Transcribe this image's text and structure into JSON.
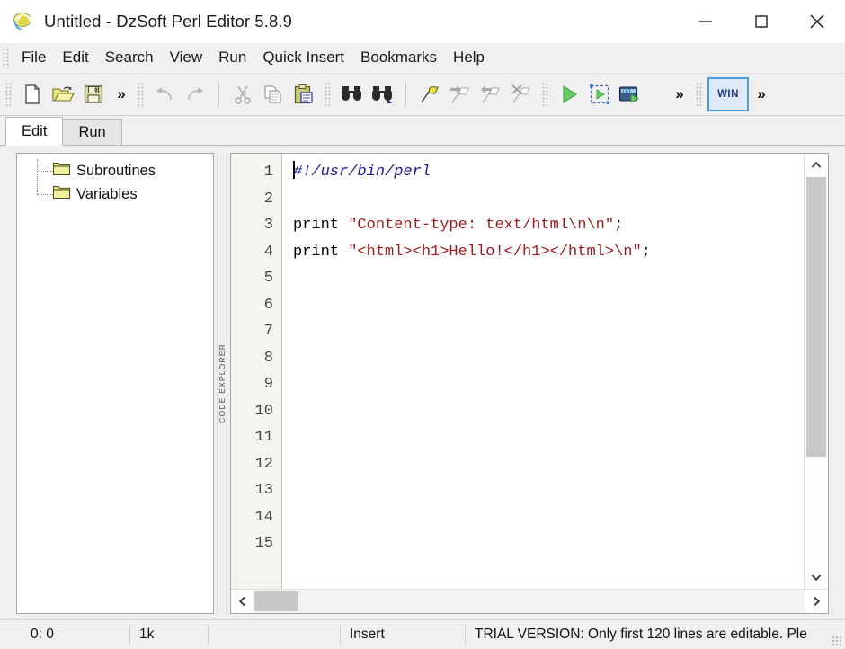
{
  "window": {
    "title": "Untitled - DzSoft Perl Editor 5.8.9",
    "app_icon": "perl-camel-icon",
    "controls": {
      "minimize": "minimize-icon",
      "maximize": "maximize-icon",
      "close": "close-icon"
    }
  },
  "menu": {
    "items": [
      {
        "label": "File"
      },
      {
        "label": "Edit"
      },
      {
        "label": "Search"
      },
      {
        "label": "View"
      },
      {
        "label": "Run"
      },
      {
        "label": "Quick Insert"
      },
      {
        "label": "Bookmarks"
      },
      {
        "label": "Help"
      }
    ]
  },
  "toolbar": {
    "overflow_label": "»",
    "win_button_label": "WIN",
    "buttons": [
      {
        "name": "new-file-icon",
        "enabled": true
      },
      {
        "name": "open-file-icon",
        "enabled": true
      },
      {
        "name": "save-file-icon",
        "enabled": true
      },
      {
        "name": "undo-icon",
        "enabled": false
      },
      {
        "name": "redo-icon",
        "enabled": false
      },
      {
        "name": "cut-icon",
        "enabled": false
      },
      {
        "name": "copy-icon",
        "enabled": false
      },
      {
        "name": "paste-icon",
        "enabled": true
      },
      {
        "name": "find-icon",
        "enabled": true
      },
      {
        "name": "find-next-icon",
        "enabled": true
      },
      {
        "name": "toggle-bookmark-icon",
        "enabled": true
      },
      {
        "name": "next-bookmark-icon",
        "enabled": false
      },
      {
        "name": "previous-bookmark-icon",
        "enabled": false
      },
      {
        "name": "clear-bookmarks-icon",
        "enabled": false
      },
      {
        "name": "run-icon",
        "enabled": true
      },
      {
        "name": "run-in-browser-icon",
        "enabled": true
      },
      {
        "name": "run-cgi-icon",
        "enabled": true
      }
    ]
  },
  "tabs": {
    "items": [
      {
        "label": "Edit",
        "active": true
      },
      {
        "label": "Run",
        "active": false
      }
    ]
  },
  "code_explorer": {
    "splitter_label": "CODE EXPLORER",
    "nodes": [
      {
        "label": "Subroutines",
        "icon": "folder-icon"
      },
      {
        "label": "Variables",
        "icon": "folder-icon"
      }
    ]
  },
  "editor": {
    "line_numbers": [
      "1",
      "2",
      "3",
      "4",
      "5",
      "6",
      "7",
      "8",
      "9",
      "10",
      "11",
      "12",
      "13",
      "14",
      "15"
    ],
    "lines": [
      {
        "n": 1,
        "tokens": [
          {
            "t": "comment",
            "v": "#!/usr/bin/perl"
          }
        ]
      },
      {
        "n": 2,
        "tokens": []
      },
      {
        "n": 3,
        "tokens": [
          {
            "t": "plain",
            "v": "print "
          },
          {
            "t": "string",
            "v": "\"Content-type: text/html\\n\\n\""
          },
          {
            "t": "plain",
            "v": ";"
          }
        ]
      },
      {
        "n": 4,
        "tokens": [
          {
            "t": "plain",
            "v": "print "
          },
          {
            "t": "string",
            "v": "\"<html><h1>Hello!</h1></html>\\n\""
          },
          {
            "t": "plain",
            "v": ";"
          }
        ]
      },
      {
        "n": 5,
        "tokens": []
      },
      {
        "n": 6,
        "tokens": []
      },
      {
        "n": 7,
        "tokens": []
      },
      {
        "n": 8,
        "tokens": []
      },
      {
        "n": 9,
        "tokens": []
      },
      {
        "n": 10,
        "tokens": []
      },
      {
        "n": 11,
        "tokens": []
      },
      {
        "n": 12,
        "tokens": []
      },
      {
        "n": 13,
        "tokens": []
      },
      {
        "n": 14,
        "tokens": []
      },
      {
        "n": 15,
        "tokens": []
      }
    ]
  },
  "statusbar": {
    "position": "0:  0",
    "size": "1k",
    "blank": "",
    "mode": "Insert",
    "trial": "TRIAL VERSION: Only first 120 lines are editable. Ple"
  },
  "colors": {
    "comment": "#1a1a8c",
    "string": "#9b1b1b",
    "plain": "#000000",
    "accent": "#4a9fe0",
    "win_button_bg": "#dceaf7",
    "folder": "#e8e87a"
  }
}
